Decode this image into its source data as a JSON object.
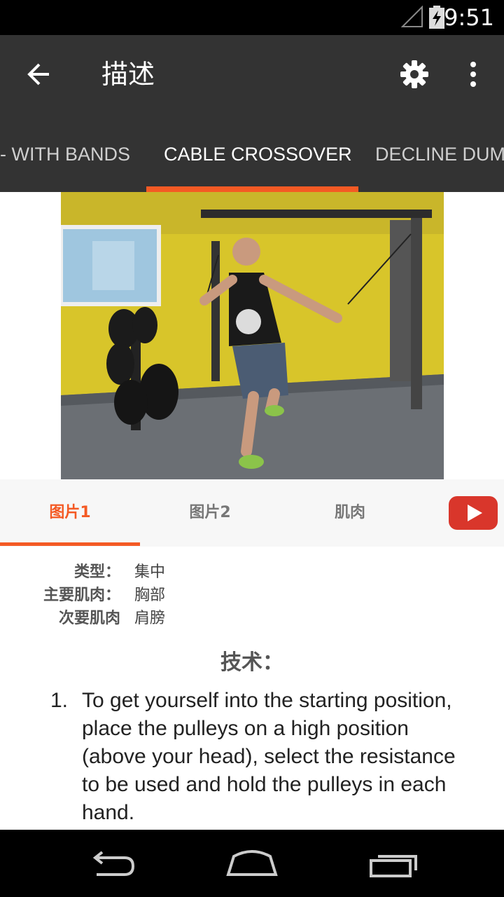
{
  "status_bar": {
    "time": "9:51",
    "signal_icon": "signal-icon",
    "battery_icon": "battery-charging-icon"
  },
  "app_bar": {
    "back_icon": "arrow-back-icon",
    "title": "描述",
    "settings_icon": "gear-icon",
    "more_icon": "more-vert-icon"
  },
  "tabs": [
    {
      "label": "- WITH BANDS",
      "active": false
    },
    {
      "label": "CABLE CROSSOVER",
      "active": true
    },
    {
      "label": "DECLINE DUM",
      "active": false
    }
  ],
  "colors": {
    "accent": "#f45a24",
    "app_bar": "#333333",
    "youtube_red": "#d9362b"
  },
  "subtabs": [
    {
      "label": "图片1",
      "active": true
    },
    {
      "label": "图片2",
      "active": false
    },
    {
      "label": "肌肉",
      "active": false
    }
  ],
  "youtube_icon": "youtube-icon",
  "info": {
    "type_label": "类型：",
    "type_value": "集中",
    "primary_label": "主要肌肉：",
    "primary_value": "胸部",
    "secondary_label": "次要肌肉",
    "secondary_value": "肩膀"
  },
  "technique": {
    "title": "技术：",
    "steps": [
      {
        "num": "1.",
        "text": "To get yourself into the starting position, place the pulleys on a high position (above your head), select the resistance to be used and hold the pulleys in each hand."
      }
    ]
  },
  "nav_bar": {
    "back_icon": "nav-back-icon",
    "home_icon": "nav-home-icon",
    "recents_icon": "nav-recents-icon"
  }
}
